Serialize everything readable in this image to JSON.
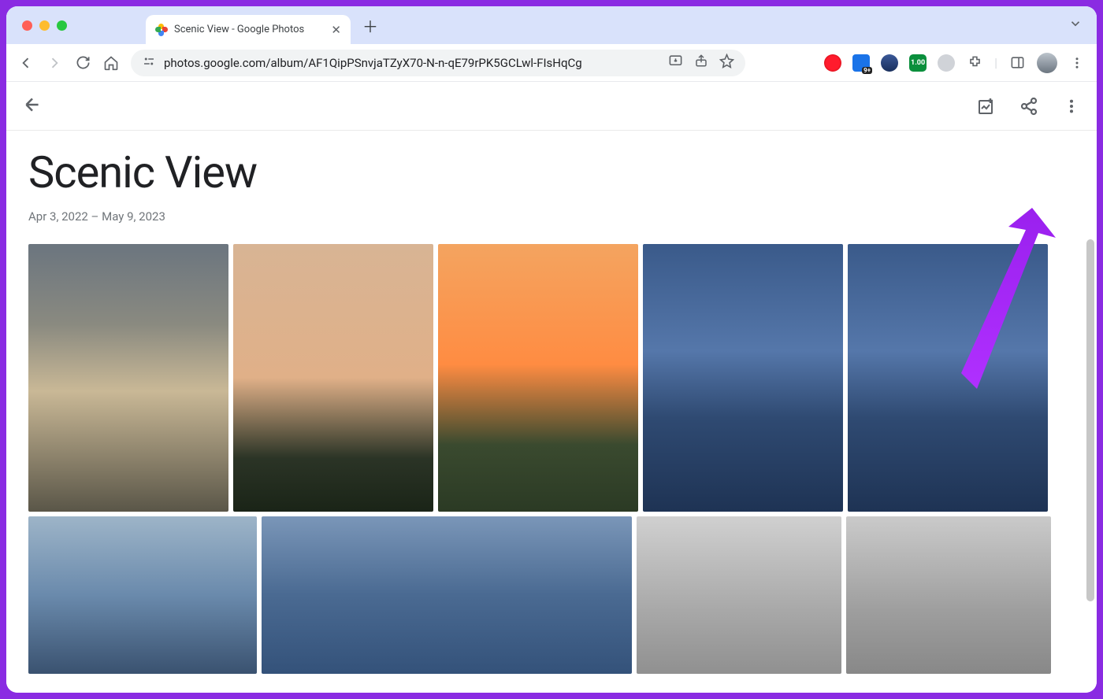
{
  "browser": {
    "tab_title": "Scenic View - Google Photos",
    "url": "photos.google.com/album/AF1QipPSnvjaTZyX70-N-n-qE79rPK5GCLwl-FIsHqCg",
    "ext_badge_blue": "9+",
    "ext_badge_green": "1.00"
  },
  "album": {
    "title": "Scenic View",
    "date_range": "Apr 3, 2022 – May 9, 2023"
  },
  "actions": {
    "add_photos": "Add photos",
    "share": "Share",
    "more": "More options",
    "back": "Back"
  }
}
